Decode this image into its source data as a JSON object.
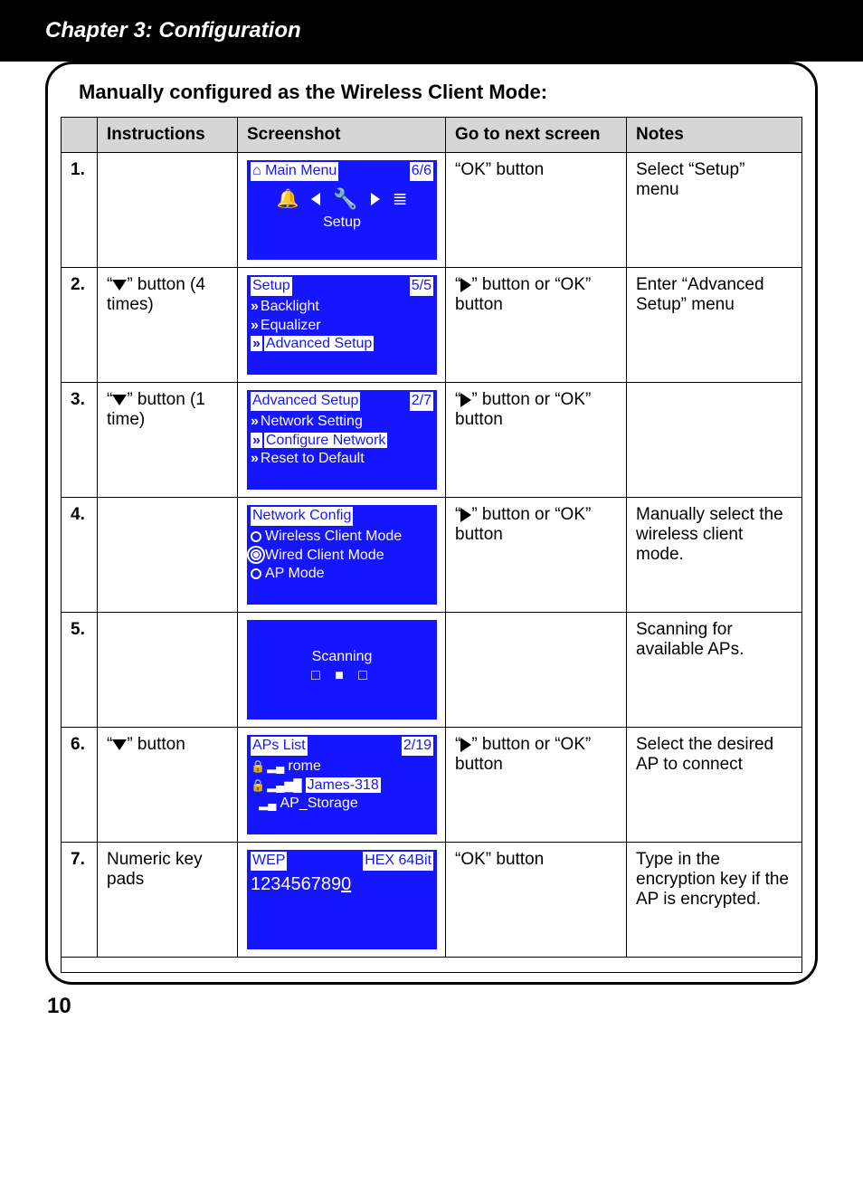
{
  "chapter_header": "Chapter 3: Configuration",
  "section_title": "Manually configured as the Wireless Client Mode:",
  "page_number": "10",
  "headers": {
    "instructions": "Instructions",
    "screenshot": "Screenshot",
    "go_next": "Go to next screen",
    "notes": "Notes"
  },
  "rows": [
    {
      "num": "1.",
      "instruction_prefix": "",
      "instruction_icon": "",
      "instruction_suffix": "",
      "go_prefix": "“OK” button",
      "go_icon": "",
      "go_suffix": "",
      "notes": "Select “Setup” menu",
      "lcd": {
        "title_left": "⌂ Main Menu",
        "title_right": "6/6",
        "type": "mainmenu",
        "bottom": "Setup"
      }
    },
    {
      "num": "2.",
      "instruction_prefix": "“",
      "instruction_icon": "down",
      "instruction_suffix": "” button (4 times)",
      "go_prefix": "“",
      "go_icon": "right",
      "go_suffix": "” button or “OK” button",
      "notes": "Enter “Advanced Setup” menu",
      "lcd": {
        "title_left": "Setup",
        "title_right": "5/5",
        "type": "list",
        "items": [
          "Backlight",
          "Equalizer",
          "Advanced Setup"
        ],
        "highlight_index": 2
      }
    },
    {
      "num": "3.",
      "instruction_prefix": "“",
      "instruction_icon": "down",
      "instruction_suffix": "” button (1 time)",
      "go_prefix": "“",
      "go_icon": "right",
      "go_suffix": "” button or “OK” button",
      "notes": "",
      "lcd": {
        "title_left": "Advanced Setup",
        "title_right": "2/7",
        "type": "list",
        "items": [
          "Network Setting",
          "Configure Network",
          "Reset to Default"
        ],
        "highlight_index": 1
      }
    },
    {
      "num": "4.",
      "instruction_prefix": "",
      "instruction_icon": "",
      "instruction_suffix": "",
      "go_prefix": "“",
      "go_icon": "right",
      "go_suffix": "” button or “OK” button",
      "notes": "Manually select the wireless client mode.",
      "lcd": {
        "title_left": "Network Config",
        "title_right": "",
        "type": "radio",
        "items": [
          "Wireless Client Mode",
          "Wired Client Mode",
          "AP Mode"
        ],
        "selected_index": 1
      }
    },
    {
      "num": "5.",
      "instruction_prefix": "",
      "instruction_icon": "",
      "instruction_suffix": "",
      "go_prefix": "",
      "go_icon": "",
      "go_suffix": "",
      "notes": "Scanning for available APs.",
      "lcd": {
        "type": "scanning",
        "line1": "Scanning",
        "line2": "□ ■ □"
      }
    },
    {
      "num": "6.",
      "instruction_prefix": "“",
      "instruction_icon": "down",
      "instruction_suffix": "” button",
      "go_prefix": "“",
      "go_icon": "right",
      "go_suffix": "” button or “OK” button",
      "notes": "Select the desired AP to connect",
      "lcd": {
        "title_left": "APs List",
        "title_right": "2/19",
        "type": "aplist",
        "items": [
          {
            "lock": true,
            "sig": "▂▄",
            "name": "rome"
          },
          {
            "lock": true,
            "sig": "▂▄▆█",
            "name": "James-318",
            "hl": true
          },
          {
            "lock": false,
            "sig": "▂▄",
            "name": "AP_Storage"
          }
        ]
      }
    },
    {
      "num": "7.",
      "instruction_prefix": "Numeric key pads",
      "instruction_icon": "",
      "instruction_suffix": "",
      "go_prefix": "“OK” button",
      "go_icon": "",
      "go_suffix": "",
      "notes": "Type in the encryption key if the AP is encrypted.",
      "lcd": {
        "title_left": "WEP",
        "title_right": "HEX 64Bit",
        "type": "wep",
        "value": "1234567890"
      }
    }
  ]
}
